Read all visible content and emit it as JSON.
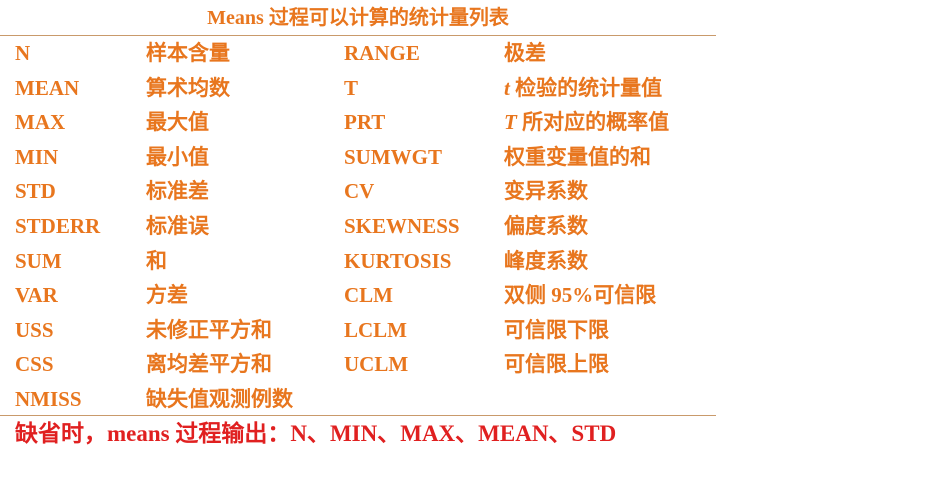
{
  "title": "Means 过程可以计算的统计量列表",
  "rows": [
    {
      "left_code": "N",
      "left_desc": "样本含量",
      "right_code": "RANGE",
      "right_desc": "极差"
    },
    {
      "left_code": "MEAN",
      "left_desc": "算术均数",
      "right_code": "T",
      "right_desc_italic": "t",
      "right_desc": " 检验的统计量值"
    },
    {
      "left_code": "MAX",
      "left_desc": "最大值",
      "right_code": "PRT",
      "right_desc_italic": "T",
      "right_desc": " 所对应的概率值"
    },
    {
      "left_code": "MIN",
      "left_desc": "最小值",
      "right_code": "SUMWGT",
      "right_desc": "权重变量值的和"
    },
    {
      "left_code": "STD",
      "left_desc": "标准差",
      "right_code": "CV",
      "right_desc": "变异系数"
    },
    {
      "left_code": "STDERR",
      "left_desc": "标准误",
      "right_code": "SKEWNESS",
      "right_desc": "偏度系数"
    },
    {
      "left_code": "SUM",
      "left_desc": "和",
      "right_code": "KURTOSIS",
      "right_desc": "峰度系数"
    },
    {
      "left_code": "VAR",
      "left_desc": "方差",
      "right_code": "CLM",
      "right_desc": "双侧 95%可信限"
    },
    {
      "left_code": "USS",
      "left_desc": "未修正平方和",
      "right_code": "LCLM",
      "right_desc": "可信限下限"
    },
    {
      "left_code": "CSS",
      "left_desc": "离均差平方和",
      "right_code": "UCLM",
      "right_desc": "可信限上限"
    },
    {
      "left_code": "NMISS",
      "left_desc": "缺失值观测例数",
      "right_code": "",
      "right_desc": ""
    }
  ],
  "footer": "缺省时，means 过程输出：N、MIN、MAX、MEAN、STD",
  "colors": {
    "text_orange": "#e8761e",
    "footer_red": "#e02020",
    "rule": "#c99a6b"
  }
}
